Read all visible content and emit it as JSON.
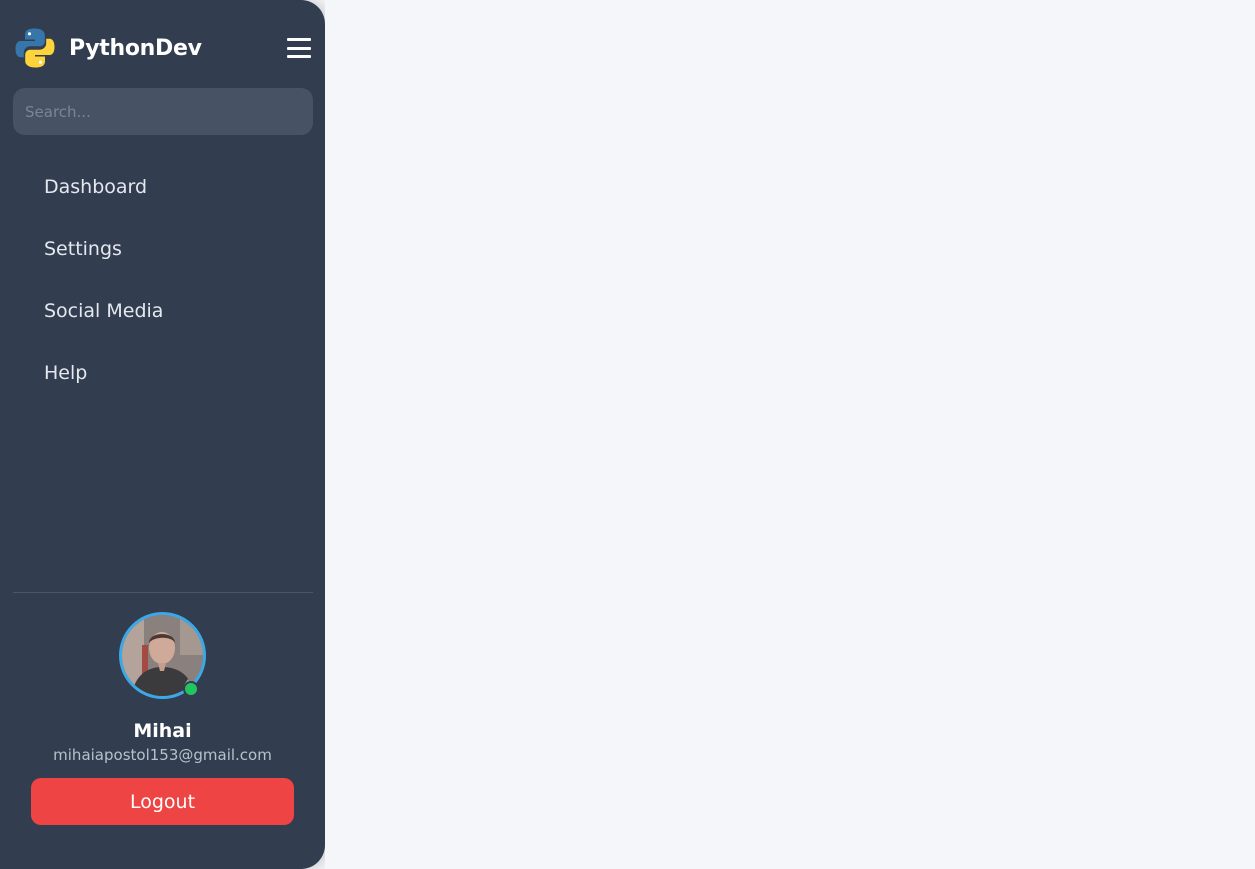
{
  "brand": {
    "name": "PythonDev",
    "logo_icon": "python-logo-icon",
    "menu_icon": "hamburger-menu-icon"
  },
  "search": {
    "placeholder": "Search...",
    "value": ""
  },
  "nav": {
    "items": [
      {
        "label": "Dashboard"
      },
      {
        "label": "Settings"
      },
      {
        "label": "Social Media"
      },
      {
        "label": "Help"
      }
    ]
  },
  "user": {
    "name": "Mihai",
    "email": "mihaiapostol153@gmail.com",
    "status": "online"
  },
  "logout": {
    "label": "Logout"
  },
  "colors": {
    "sidebar_bg": "#323d4f",
    "page_bg": "#f4f6fa",
    "search_bg": "#475264",
    "avatar_ring": "#3ba9e8",
    "status_online": "#22c55e",
    "logout_bg": "#ef4444"
  }
}
